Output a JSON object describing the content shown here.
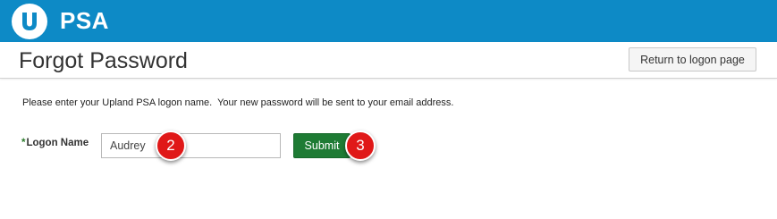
{
  "brand": {
    "logo_icon": "upland-u-logo-icon",
    "name": "PSA",
    "bar_color": "#0d8ac6"
  },
  "header": {
    "title": "Forgot Password",
    "return_button_label": "Return to logon page"
  },
  "form": {
    "instructions": "Please enter your Upland PSA logon name.  Your new password will be sent to your email address.",
    "logon_label_required_mark": "*",
    "logon_label": "Logon Name",
    "logon_value": "Audrey",
    "submit_label": "Submit",
    "submit_color": "#1e7b34"
  },
  "annotations": {
    "marker_color": "#e01818",
    "markers": [
      "2",
      "3"
    ]
  }
}
